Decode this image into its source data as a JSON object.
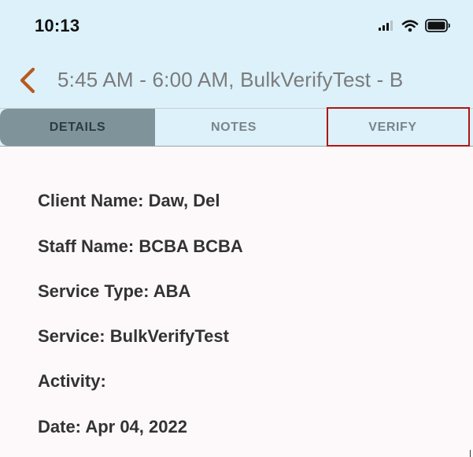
{
  "status_bar": {
    "time": "10:13",
    "icons": [
      "cellular-signal-icon",
      "wifi-icon",
      "battery-icon"
    ]
  },
  "nav": {
    "back_icon": "chevron-left-icon",
    "title": "5:45 AM - 6:00 AM, BulkVerifyTest - B"
  },
  "tabs": [
    {
      "label": "DETAILS",
      "selected": true
    },
    {
      "label": "NOTES",
      "selected": false
    },
    {
      "label": "VERIFY",
      "selected": false,
      "highlighted": true
    }
  ],
  "details": [
    {
      "label": "Client Name:",
      "value": "Daw, Del"
    },
    {
      "label": "Staff Name:",
      "value": "BCBA BCBA"
    },
    {
      "label": "Service Type:",
      "value": "ABA"
    },
    {
      "label": "Service:",
      "value": "BulkVerifyTest"
    },
    {
      "label": "Activity:",
      "value": ""
    },
    {
      "label": "Date:",
      "value": "Apr 04, 2022"
    }
  ],
  "colors": {
    "header_bg": "#dcf1fa",
    "selected_tab_bg": "#7f939b",
    "back_arrow": "#b85a1f",
    "highlight_border": "#b01515",
    "content_bg": "#fdf9fa"
  }
}
